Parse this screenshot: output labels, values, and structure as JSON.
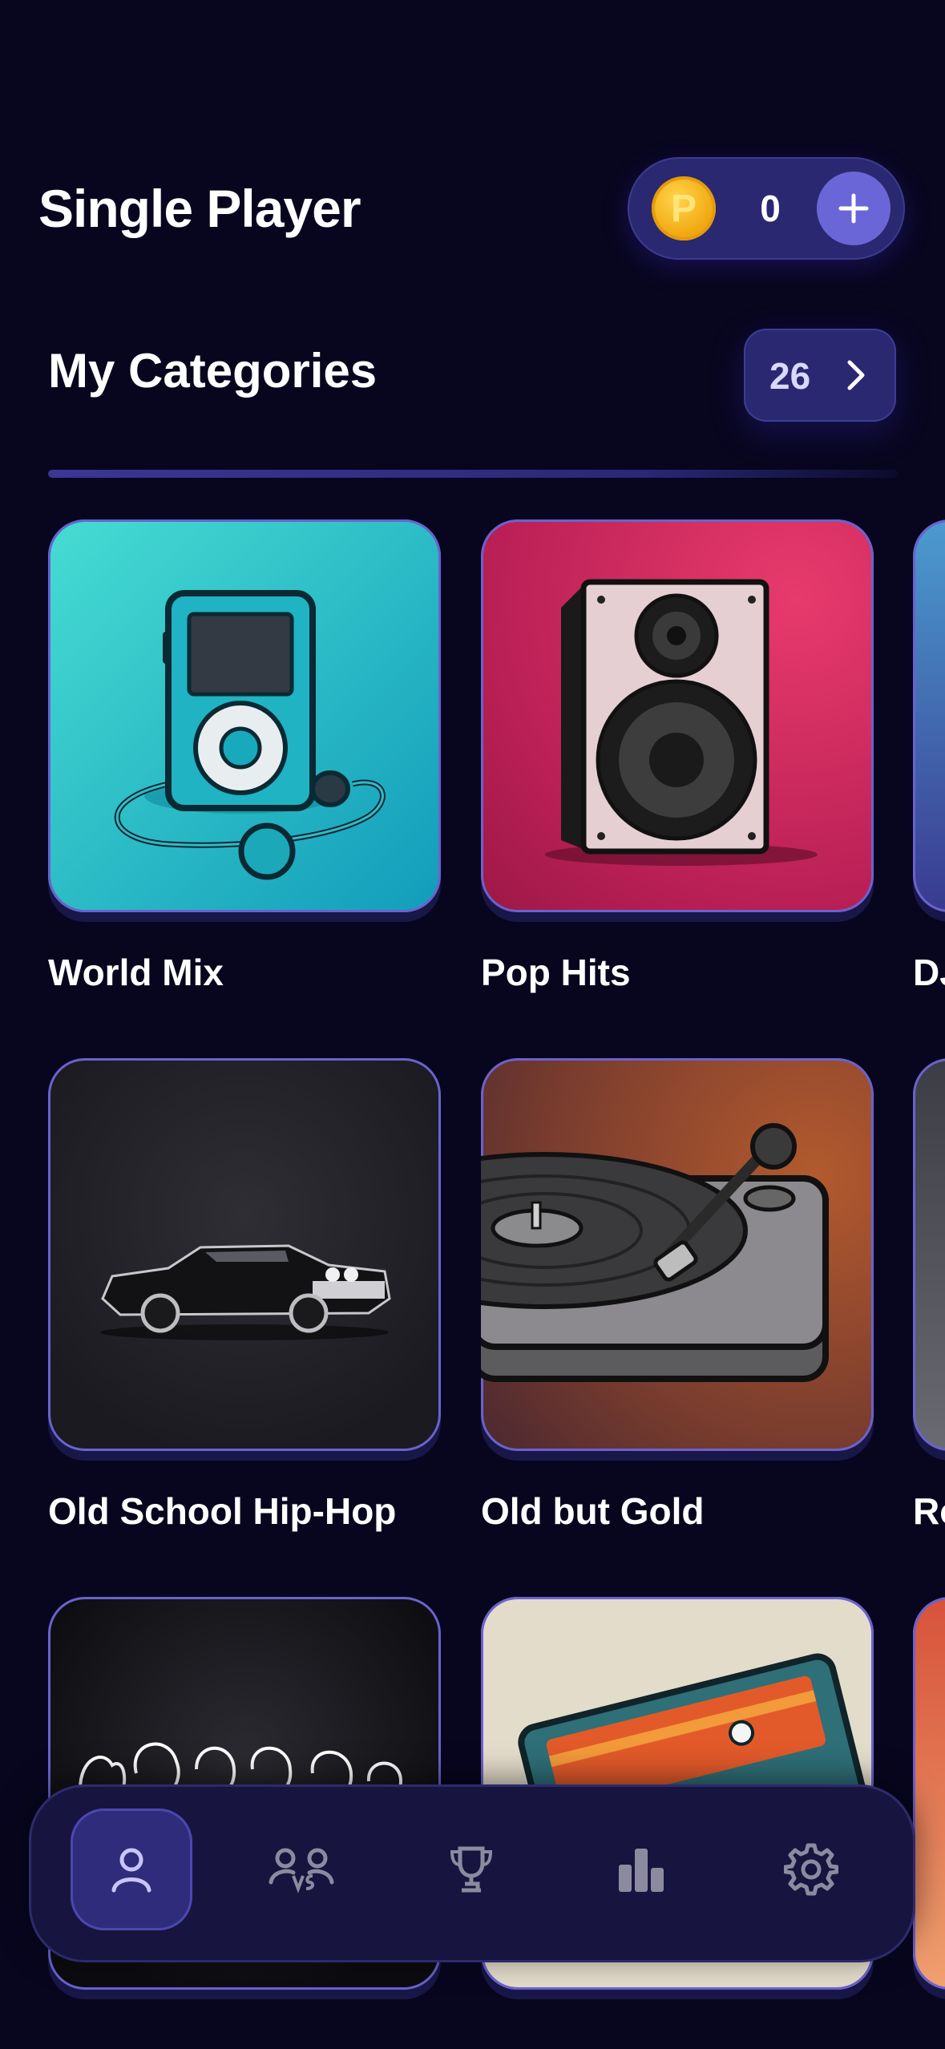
{
  "header": {
    "title": "Single Player",
    "coins": {
      "icon": "coin-icon",
      "coin_letter": "P",
      "count": "0",
      "add_icon": "plus-icon"
    }
  },
  "categories_section": {
    "title": "My Categories",
    "count": "26",
    "chevron_icon": "chevron-right-icon"
  },
  "categories": [
    {
      "label": "World Mix",
      "image": "mp3-player-earbuds-illustration",
      "bg": "#19b4c4"
    },
    {
      "label": "Pop Hits",
      "image": "speaker-illustration",
      "bg": "#c5265e"
    },
    {
      "label": "DJ",
      "image": "partial-tile",
      "bg": "#4a5aa8"
    },
    {
      "label": "Old School Hip-Hop",
      "image": "lowrider-car-illustration",
      "bg": "#202028"
    },
    {
      "label": "Old but Gold",
      "image": "turntable-illustration",
      "bg": "#8a4a30"
    },
    {
      "label": "Ro",
      "image": "partial-tile",
      "bg": "#5c5c66"
    },
    {
      "label": "",
      "image": "band-silhouette-illustration",
      "bg": "#141418"
    },
    {
      "label": "",
      "image": "cassette-tape-illustration",
      "bg": "#e2d8c6"
    },
    {
      "label": "",
      "image": "partial-tile",
      "bg": "#d86a45"
    }
  ],
  "tabbar": {
    "tabs": [
      {
        "name": "single-player",
        "icon": "person-icon",
        "active": true
      },
      {
        "name": "versus",
        "icon": "versus-icon",
        "active": false
      },
      {
        "name": "trophies",
        "icon": "trophy-icon",
        "active": false
      },
      {
        "name": "leaderboard",
        "icon": "bar-chart-icon",
        "active": false
      },
      {
        "name": "settings",
        "icon": "gear-icon",
        "active": false
      }
    ]
  },
  "colors": {
    "background": "#08061f",
    "accent": "#6a66d8",
    "pill": "#2a2870",
    "tile_border": "#6a62cf",
    "inactive_icon": "#8c8a9e"
  }
}
